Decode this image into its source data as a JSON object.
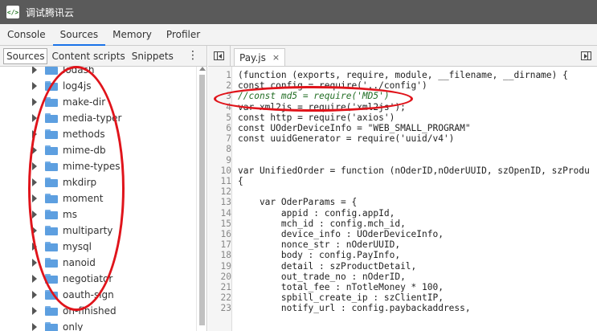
{
  "window": {
    "title": "调试腾讯云",
    "icon": "code-icon"
  },
  "tabs": [
    {
      "label": "Console"
    },
    {
      "label": "Sources"
    },
    {
      "label": "Memory"
    },
    {
      "label": "Profiler"
    }
  ],
  "navigator": {
    "subtabs": [
      {
        "label": "Sources"
      },
      {
        "label": "Content scripts"
      },
      {
        "label": "Snippets"
      }
    ],
    "more_icon": "more-vert-icon",
    "items": [
      "lodash",
      "log4js",
      "make-dir",
      "media-typer",
      "methods",
      "mime-db",
      "mime-types",
      "mkdirp",
      "moment",
      "ms",
      "multiparty",
      "mysql",
      "nanoid",
      "negotiator",
      "oauth-sign",
      "on-finished",
      "only"
    ]
  },
  "editor": {
    "file_tab": "Pay.js",
    "close_glyph": "×",
    "lines": [
      {
        "n": "1",
        "text": "(function (exports, require, module, __filename, __dirname) {"
      },
      {
        "n": "2",
        "text": "const config = require('../config')"
      },
      {
        "n": "3",
        "text": "//const md5 = require('MD5')",
        "kind": "comment"
      },
      {
        "n": "4",
        "text": "var xml2js = require('xml2js');"
      },
      {
        "n": "5",
        "text": "const http = require('axios')"
      },
      {
        "n": "6",
        "text": "const UOderDeviceInfo = \"WEB_SMALL_PROGRAM\""
      },
      {
        "n": "7",
        "text": "const uuidGenerator = require('uuid/v4')"
      },
      {
        "n": "8",
        "text": ""
      },
      {
        "n": "9",
        "text": ""
      },
      {
        "n": "10",
        "text": "var UnifiedOrder = function (nOderID,nOderUUID, szOpenID, szProdu"
      },
      {
        "n": "11",
        "text": "{"
      },
      {
        "n": "12",
        "text": ""
      },
      {
        "n": "13",
        "text": "    var OderParams = {"
      },
      {
        "n": "14",
        "text": "        appid : config.appId,"
      },
      {
        "n": "15",
        "text": "        mch_id : config.mch_id,"
      },
      {
        "n": "16",
        "text": "        device_info : UOderDeviceInfo,"
      },
      {
        "n": "17",
        "text": "        nonce_str : nOderUUID,"
      },
      {
        "n": "18",
        "text": "        body : config.PayInfo,"
      },
      {
        "n": "19",
        "text": "        detail : szProductDetail,"
      },
      {
        "n": "20",
        "text": "        out_trade_no : nOderID,"
      },
      {
        "n": "21",
        "text": "        total_fee : nTotleMoney * 100,"
      },
      {
        "n": "22",
        "text": "        spbill_create_ip : szClientIP,"
      },
      {
        "n": "23",
        "text": "        notify_url : config.paybackaddress,"
      }
    ]
  },
  "annotations": {
    "color": "#e0141b"
  },
  "colors": {
    "accent": "#1a73e8",
    "folder": "#5d9fe0",
    "comment": "#236e25"
  }
}
